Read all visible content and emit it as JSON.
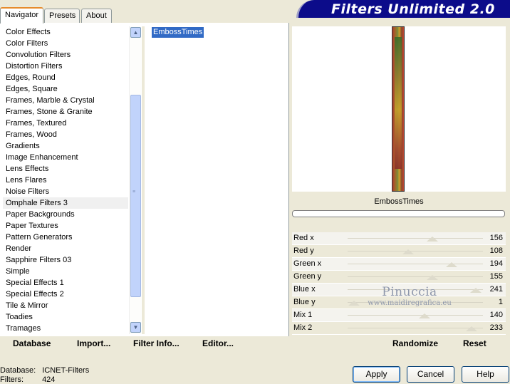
{
  "tabs": [
    "Navigator",
    "Presets",
    "About"
  ],
  "banner_title": "Filters Unlimited 2.0",
  "categories": [
    "Color Effects",
    "Color Filters",
    "Convolution Filters",
    "Distortion Filters",
    "Edges, Round",
    "Edges, Square",
    "Frames, Marble & Crystal",
    "Frames, Stone & Granite",
    "Frames, Textured",
    "Frames, Wood",
    "Gradients",
    "Image Enhancement",
    "Lens Effects",
    "Lens Flares",
    "Noise Filters",
    "Omphale Filters 3",
    "Paper Backgrounds",
    "Paper Textures",
    "Pattern Generators",
    "Render",
    "Sapphire Filters 03",
    "Simple",
    "Special Effects 1",
    "Special Effects 2",
    "Tile & Mirror",
    "Toadies",
    "Tramages"
  ],
  "selected_category": "Omphale Filters 3",
  "filters": [
    "EmbossTimes"
  ],
  "selected_filter": "EmbossTimes",
  "preview": {
    "filter_name": "EmbossTimes"
  },
  "params": [
    {
      "label": "Red x",
      "value": 156
    },
    {
      "label": "Red y",
      "value": 108
    },
    {
      "label": "Green x",
      "value": 194
    },
    {
      "label": "Green y",
      "value": 155
    },
    {
      "label": "Blue x",
      "value": 241
    },
    {
      "label": "Blue y",
      "value": 1
    },
    {
      "label": "Mix 1",
      "value": 140
    },
    {
      "label": "Mix 2",
      "value": 233
    }
  ],
  "watermark": {
    "line1": "Pinuccia",
    "line2": "www.maidiregrafica.eu"
  },
  "toolbar": {
    "database": "Database",
    "import": "Import...",
    "filter_info": "Filter Info...",
    "editor": "Editor...",
    "randomize": "Randomize",
    "reset": "Reset"
  },
  "status": {
    "database_label": "Database:",
    "database_value": "ICNET-Filters",
    "filters_label": "Filters:",
    "filters_value": "424"
  },
  "buttons": {
    "apply": "Apply",
    "cancel": "Cancel",
    "help": "Help"
  },
  "colors": {
    "banner": "#0c0c8a",
    "selection": "#316ac5",
    "face": "#ece9d8"
  }
}
